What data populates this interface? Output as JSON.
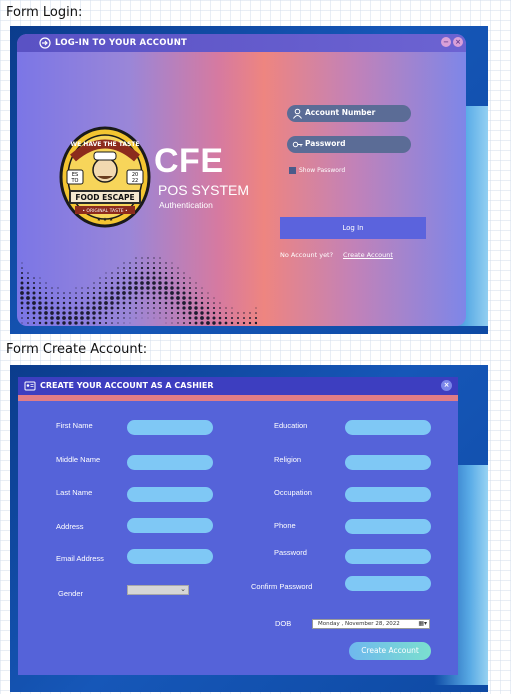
{
  "captions": {
    "login": "Form Login:",
    "create": "Form Create Account:"
  },
  "login_form": {
    "title": "LOG-IN TO YOUR ACCOUNT",
    "title_icon": "login-arrow-icon",
    "window_buttons": [
      "minimize",
      "close"
    ],
    "logo": {
      "top_text": "WE HAVE THE TASTE",
      "left_badge": "ES TO",
      "right_badge": "20 22",
      "name": "FOOD ESCAPE",
      "tagline": "• ORIGINAL TASTE •"
    },
    "brand": "CFE",
    "subtitle": "POS SYSTEM",
    "subtitle2": "Authentication",
    "account_number_placeholder": "Account Number",
    "password_placeholder": "Password",
    "show_password_label": "Show Password",
    "login_button": "Log In",
    "no_account_text": "No Account yet?",
    "create_account_link": "Create Account",
    "colors": {
      "title_bar": "#5a52c4",
      "button": "#5b63dd",
      "pill": "#5b6c96"
    }
  },
  "create_form": {
    "title": "CREATE YOUR ACCOUNT AS A CASHIER",
    "title_icon": "id-card-icon",
    "left_fields": [
      "First Name",
      "Middle Name",
      "Last Name",
      "Address",
      "Email Address"
    ],
    "right_fields": [
      "Education",
      "Religion",
      "Occupation",
      "Phone",
      "Password",
      "Confirm Password"
    ],
    "gender_label": "Gender",
    "gender_value": "",
    "dob_label": "DOB",
    "dob_value": "Monday   ,  November 28, 2022",
    "create_button": "Create Account",
    "colors": {
      "window": "#5563d9",
      "title_bar": "#3d3ec0",
      "stripe": "#e07d86",
      "input": "#7fc8f5"
    }
  }
}
